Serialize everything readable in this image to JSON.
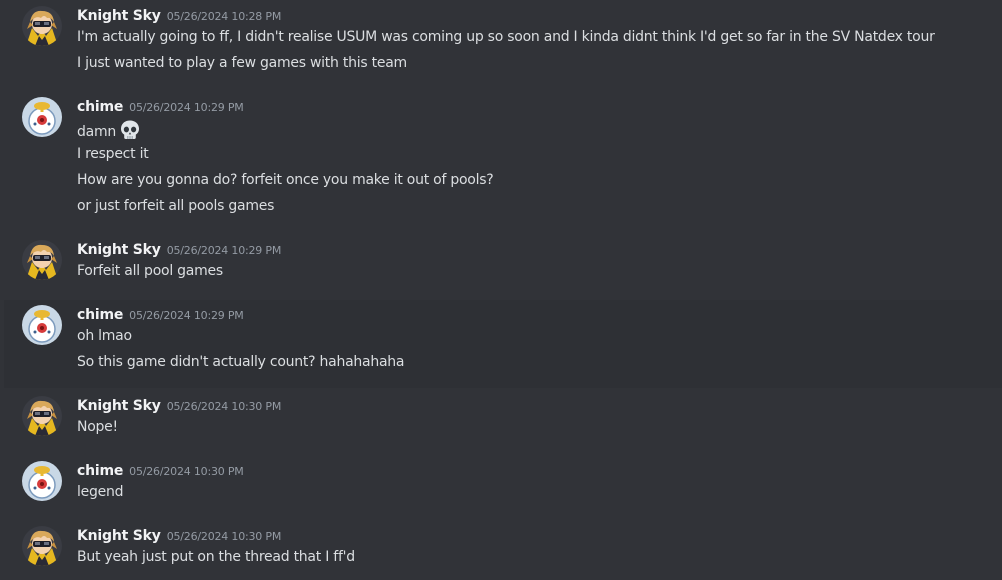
{
  "users": {
    "knight": {
      "name": "Knight Sky"
    },
    "chime": {
      "name": "chime"
    }
  },
  "messages": [
    {
      "user": "Knight Sky",
      "timestamp": "05/26/2024 10:28 PM",
      "lines": [
        "I'm actually going to ff, I didn't realise USUM was coming up so soon and I kinda didnt think I'd get so far in the SV Natdex tour",
        "I just wanted to play a few games with this team"
      ]
    },
    {
      "user": "chime",
      "timestamp": "05/26/2024 10:29 PM",
      "lines": [
        "damn",
        "I respect it",
        "How are you gonna do? forfeit once you make it out of pools?",
        "or just forfeit all pools games"
      ],
      "emoji": "skull-icon"
    },
    {
      "user": "Knight Sky",
      "timestamp": "05/26/2024 10:29 PM",
      "lines": [
        "Forfeit all pool games"
      ]
    },
    {
      "user": "chime",
      "timestamp": "05/26/2024 10:29 PM",
      "lines": [
        "oh lmao",
        "So this game didn't actually count? hahahahaha"
      ]
    },
    {
      "user": "Knight Sky",
      "timestamp": "05/26/2024 10:30 PM",
      "lines": [
        "Nope!"
      ]
    },
    {
      "user": "chime",
      "timestamp": "05/26/2024 10:30 PM",
      "lines": [
        "legend"
      ]
    },
    {
      "user": "Knight Sky",
      "timestamp": "05/26/2024 10:30 PM",
      "lines": [
        "But yeah just put on the thread that I ff'd"
      ]
    }
  ],
  "colors": {
    "background": "#313338",
    "hover_background": "#2e3035",
    "username": "#f2f3f5",
    "text": "#dbdee1",
    "timestamp": "#949ba4"
  }
}
